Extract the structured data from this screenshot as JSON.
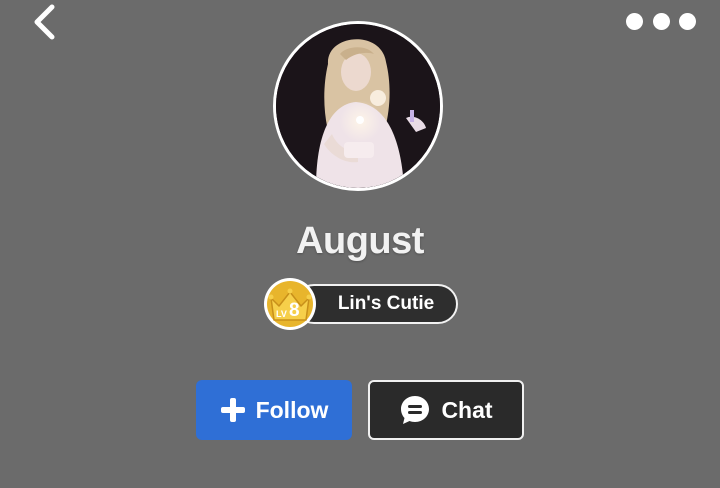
{
  "header": {
    "back_icon": "chevron-left-icon",
    "more_icon": "more-dots-icon"
  },
  "profile": {
    "username": "August",
    "level_badge": {
      "prefix": "LV",
      "level": "8",
      "icon": "crown-icon",
      "color": "#e8b52c"
    },
    "title": "Lin's Cutie"
  },
  "actions": {
    "follow": {
      "label": "Follow",
      "icon": "plus-icon",
      "color": "#2f6fd6"
    },
    "chat": {
      "label": "Chat",
      "icon": "chat-bubble-icon",
      "color": "#2a2a2a"
    }
  },
  "colors": {
    "background": "#6b6b6b"
  }
}
